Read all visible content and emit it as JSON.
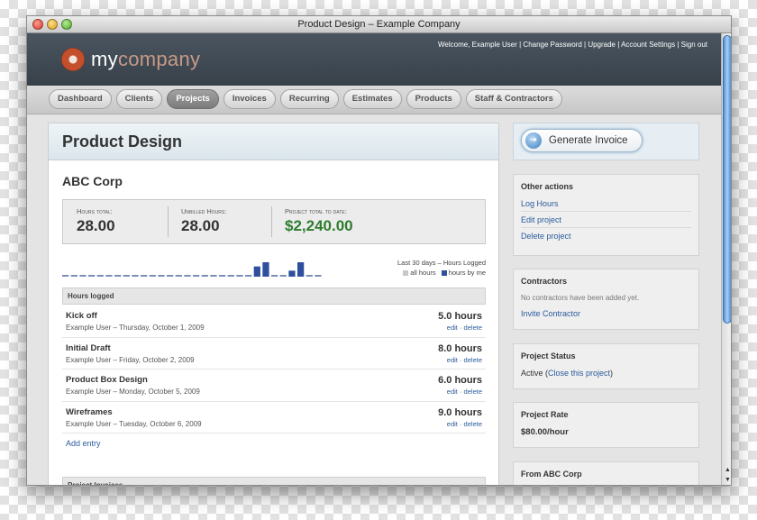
{
  "window": {
    "title": "Product Design – Example Company"
  },
  "header": {
    "logo_prefix": "my",
    "logo_suffix": "company",
    "user_links": "Welcome, Example User | Change Password | Upgrade | Account Settings | Sign out"
  },
  "nav": {
    "tabs": [
      {
        "label": "Dashboard"
      },
      {
        "label": "Clients"
      },
      {
        "label": "Projects",
        "active": true
      },
      {
        "label": "Invoices"
      },
      {
        "label": "Recurring"
      },
      {
        "label": "Estimates"
      },
      {
        "label": "Products"
      },
      {
        "label": "Staff & Contractors"
      }
    ]
  },
  "project": {
    "title": "Product Design",
    "client": "ABC Corp",
    "stats": [
      {
        "label": "Hours total:",
        "value": "28.00"
      },
      {
        "label": "Unbilled Hours:",
        "value": "28.00"
      },
      {
        "label": "Project total to date:",
        "value": "$2,240.00"
      }
    ],
    "chart_legend": {
      "title": "Last 30 days – Hours Logged",
      "all_label": "all hours",
      "mine_label": "hours by me"
    },
    "sparkline_mine_hours": [
      0,
      0,
      0,
      0,
      0,
      0,
      0,
      0,
      0,
      0,
      0,
      0,
      0,
      0,
      0,
      0,
      0,
      0,
      0,
      0,
      0,
      0,
      2,
      3,
      0,
      0,
      1,
      3,
      0,
      0
    ],
    "colors": {
      "all_hours": "#c8c8c8",
      "my_hours": "#2e4f9e"
    }
  },
  "hours_logged": {
    "heading": "Hours logged",
    "entries": [
      {
        "title": "Kick off",
        "meta": "Example User – Thursday, October 1, 2009",
        "hours": "5.0 hours",
        "actions": "edit · delete"
      },
      {
        "title": "Initial Draft",
        "meta": "Example User – Friday, October 2, 2009",
        "hours": "8.0 hours",
        "actions": "edit · delete"
      },
      {
        "title": "Product Box Design",
        "meta": "Example User – Monday, October 5, 2009",
        "hours": "6.0 hours",
        "actions": "edit · delete"
      },
      {
        "title": "Wireframes",
        "meta": "Example User – Tuesday, October 6, 2009",
        "hours": "9.0 hours",
        "actions": "edit · delete"
      }
    ],
    "add_entry": "Add entry"
  },
  "project_invoices": {
    "heading": "Project Invoices"
  },
  "sidebar": {
    "generate_invoice": "Generate Invoice",
    "other_actions": {
      "title": "Other actions",
      "links": [
        "Log Hours",
        "Edit project",
        "Delete project"
      ]
    },
    "contractors": {
      "title": "Contractors",
      "note": "No contractors have been added yet.",
      "link": "Invite Contractor"
    },
    "status": {
      "title": "Project Status",
      "prefix": "Active (",
      "link": "Close this project",
      "suffix": ")"
    },
    "rate": {
      "title": "Project Rate",
      "value": "$80.00/hour"
    },
    "from": {
      "title": "From ABC Corp"
    }
  }
}
